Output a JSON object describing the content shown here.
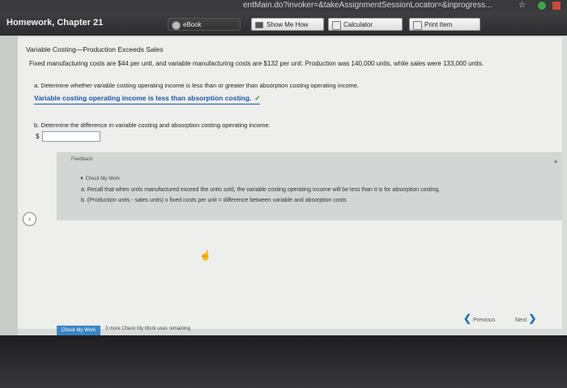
{
  "browser": {
    "url_fragment": "entMain.do?invoker=&takeAssignmentSessionLocator=&inprogress...",
    "star": "☆"
  },
  "header": {
    "title": "Homework, Chapter 21",
    "buttons": {
      "ebook": "eBook",
      "show_me_how": "Show Me How",
      "calculator": "Calculator",
      "print_item": "Print Item"
    }
  },
  "problem": {
    "section_title": "Variable Costing—Production Exceeds Sales",
    "statement": "Fixed manufacturing costs are $44 per unit, and variable manufacturing costs are $132 per unit. Production was 140,000 units, while sales were 133,000 units.",
    "part_a": {
      "question": "a.  Determine whether variable costing operating income is less than or greater than absorption costing operating income.",
      "answer": "Variable costing operating income is less than absorption costing.",
      "check": "✓"
    },
    "part_b": {
      "question": "b.  Determine the difference in variable costing and absorption costing operating income.",
      "currency": "$",
      "input_value": ""
    }
  },
  "feedback": {
    "label": "Feedback",
    "check_my_work": "▼ Check My Work",
    "hint_a": "a.  Recall that when units manufactured exceed the units sold, the variable costing operating income will be less than it is for absorption costing.",
    "hint_b": "b.  (Production units - sales units) x fixed costs per unit = difference between variable and absorption costs"
  },
  "footer": {
    "check_my_work_button": "Check My Work",
    "remaining": "3 more Check My Work uses remaining",
    "previous": "Previous",
    "next": "Next"
  }
}
